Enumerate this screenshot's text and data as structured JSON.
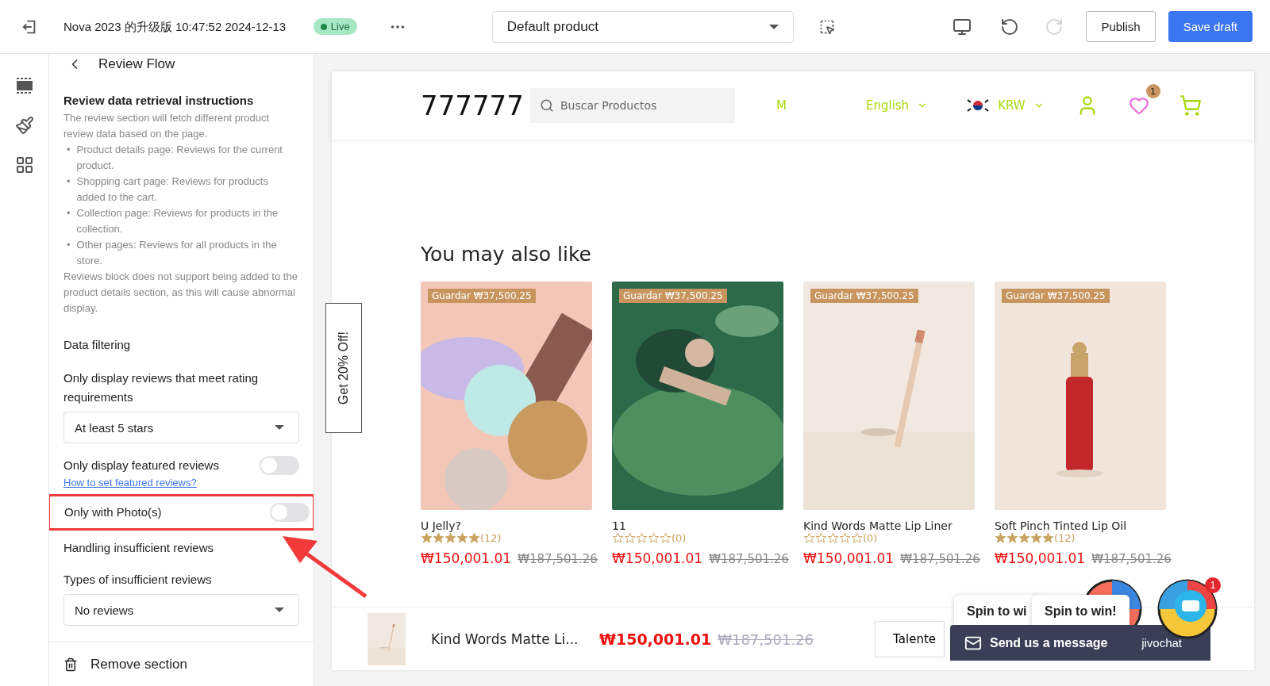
{
  "topbar": {
    "title": "Nova 2023 的升级版 10:47:52 2024-12-13",
    "status": "Live",
    "template_select": "Default product",
    "undo_disabled": false,
    "redo_disabled": true,
    "buttons": [
      {
        "label": "Publish",
        "kind": "secondary"
      },
      {
        "label": "Save draft",
        "kind": "primary"
      }
    ]
  },
  "rail": [
    {
      "selected": false
    },
    {
      "selected": false
    },
    {
      "selected": false
    }
  ],
  "panel": {
    "back_title": "Review Flow",
    "info_title": "Review data retrieval instructions",
    "info_intro": "The review section will fetch different product review data based on the page.",
    "info_items": [
      {
        "bullet": "•",
        "text": "Product details page: Reviews for the current product."
      },
      {
        "bullet": "•",
        "text": "Shopping cart page: Reviews for products added to the cart."
      },
      {
        "bullet": "•",
        "text": "Collection page: Reviews for products in the collection."
      },
      {
        "bullet": "•",
        "text": "Other pages: Reviews for all products in the store."
      }
    ],
    "info_note": "Reviews block does not support being added to the product details section, as this will cause abnormal display.",
    "filter_title": "Data filtering",
    "rating_label": "Only display reviews that meet rating requirements",
    "rating_value": "At least 5 stars",
    "toggles": [
      {
        "label": "Only display featured reviews",
        "on": false,
        "highlighted": false,
        "link": "How to set featured reviews? "
      },
      {
        "label": "Only with Photo(s)",
        "on": false,
        "highlighted": true
      }
    ],
    "insufficient_title": "Handling insufficient reviews",
    "insufficient_label": "Types of insufficient reviews",
    "insufficient_value": "No reviews",
    "remove": "Remove section"
  },
  "store": {
    "logo": "777777",
    "search_placeholder": "Buscar Productos",
    "menu_cut": "M",
    "language": "English",
    "currency": "KRW",
    "wishlist_count": "1",
    "heading": "You may also like",
    "side_tab": "Get 20% Off!",
    "products": [
      {
        "badge": "Guardar ₩37,500.25",
        "title": "U Jelly?",
        "stars": 5,
        "count": "(12)",
        "price": "₩150,001.01",
        "old_price": "₩187,501.26"
      },
      {
        "badge": "Guardar ₩37,500.25",
        "title": "11",
        "stars": 0,
        "count": "(0)",
        "price": "₩150,001.01",
        "old_price": "₩187,501.26"
      },
      {
        "badge": "Guardar ₩37,500.25",
        "title": "Kind Words Matte Lip Liner",
        "stars": 0,
        "count": "(0)",
        "price": "₩150,001.01",
        "old_price": "₩187,501.26"
      },
      {
        "badge": "Guardar ₩37,500.25",
        "title": "Soft Pinch Tinted Lip Oil",
        "stars": 5,
        "count": "(12)",
        "price": "₩150,001.01",
        "old_price": "₩187,501.26"
      }
    ],
    "sticky": {
      "title": "Kind Words Matte Li...",
      "price": "₩150,001.01",
      "old_price": "₩187,501.26",
      "button": "Talente"
    },
    "spin": [
      {
        "label": "Spin to wi"
      },
      {
        "label": "Spin to win!",
        "badge": "1"
      }
    ],
    "chat": {
      "label": "Send us a message",
      "brand": "jivochat"
    }
  }
}
